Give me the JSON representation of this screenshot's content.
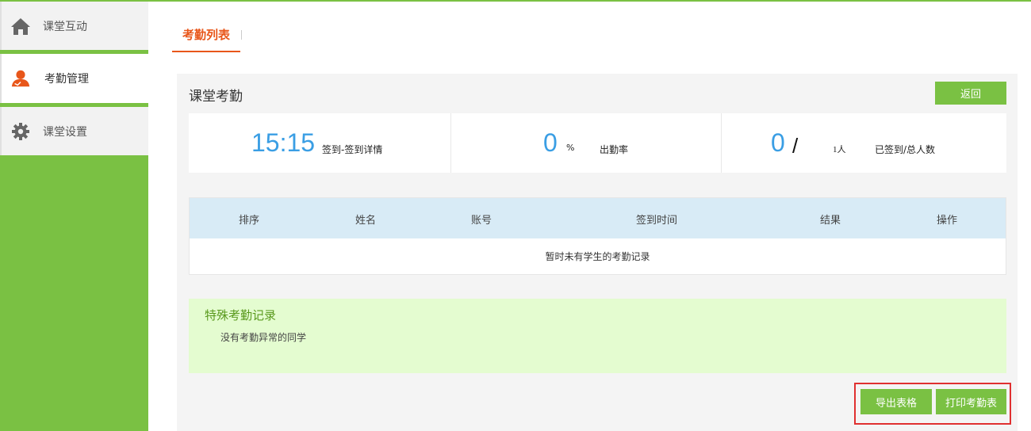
{
  "sidebar": {
    "items": [
      {
        "label": "课堂互动",
        "icon": "home-icon"
      },
      {
        "label": "考勤管理",
        "icon": "user-attendance-icon"
      },
      {
        "label": "课堂设置",
        "icon": "gear-icon"
      }
    ]
  },
  "tabs": [
    {
      "label": "考勤列表"
    }
  ],
  "panel": {
    "title": "课堂考勤",
    "back_label": "返回"
  },
  "stats": {
    "time": "15:15",
    "time_label": "签到-签到详情",
    "rate_value": "0",
    "rate_unit": "%",
    "rate_label": "出勤率",
    "signed_value": "0",
    "slash": "/",
    "total_value": "1人",
    "signed_label": "已签到/总人数"
  },
  "table": {
    "columns": [
      "排序",
      "姓名",
      "账号",
      "签到时间",
      "结果",
      "操作"
    ],
    "empty_text": "暂时未有学生的考勤记录"
  },
  "special": {
    "title": "特殊考勤记录",
    "message": "没有考勤异常的同学"
  },
  "actions": {
    "export_label": "导出表格",
    "print_label": "打印考勤表"
  },
  "colors": {
    "accent_green": "#7ac143",
    "tab_orange": "#e8561a",
    "number_blue": "#3a9ee4",
    "header_blue": "#d8ebf6",
    "special_bg": "#e4fcd0",
    "highlight_red": "#e03030"
  }
}
